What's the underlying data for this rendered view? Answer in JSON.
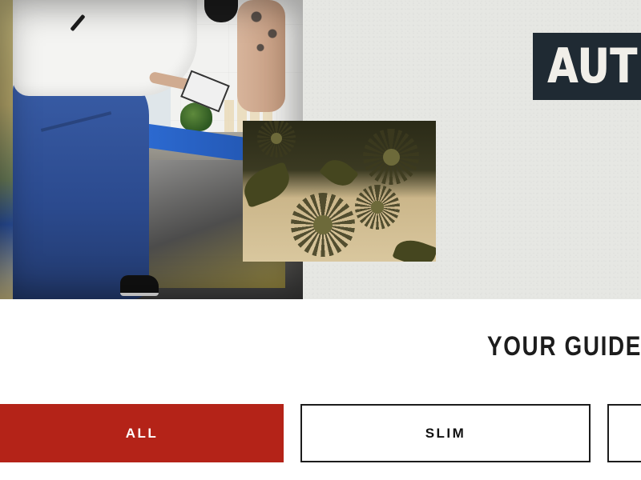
{
  "hero": {
    "headline": "AUTH",
    "label_bg_color": "#1f2a33"
  },
  "guide": {
    "heading": "YOUR GUIDE"
  },
  "filters": {
    "items": [
      {
        "label": "ALL",
        "active": true
      },
      {
        "label": "SLIM",
        "active": false
      },
      {
        "label": "",
        "active": false
      }
    ],
    "active_color": "#b42318"
  }
}
